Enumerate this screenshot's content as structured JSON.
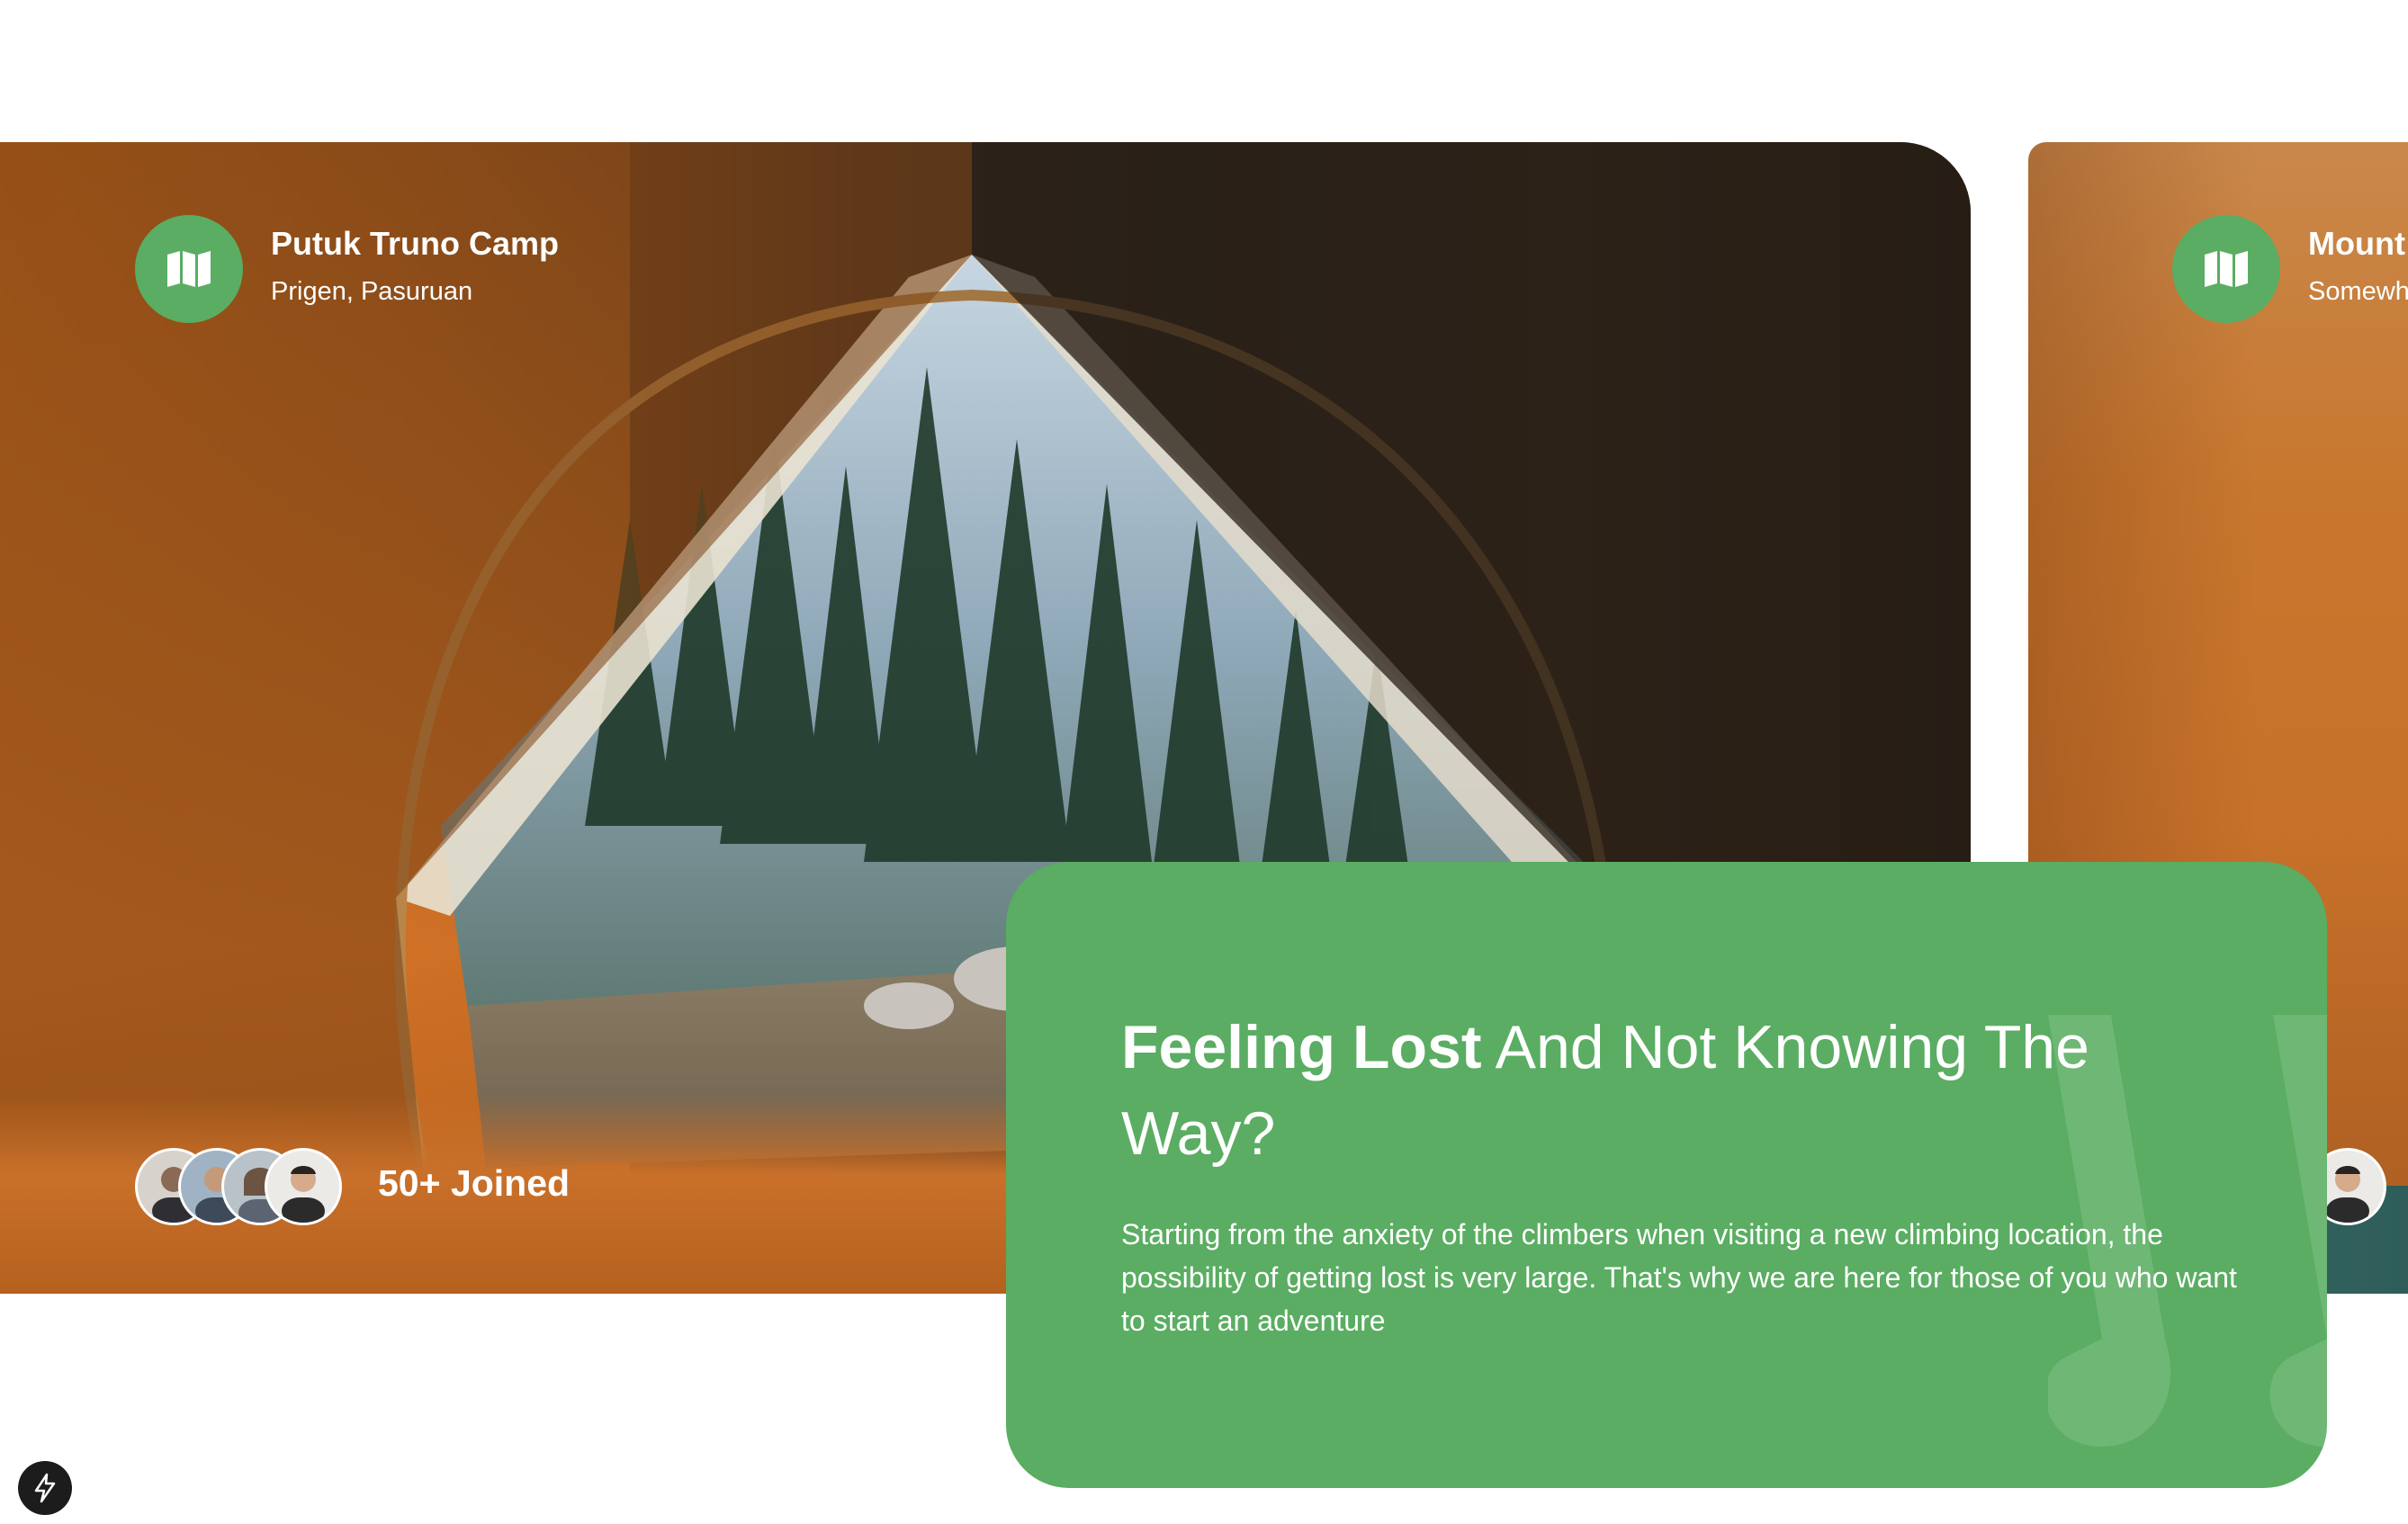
{
  "cards": [
    {
      "title": "Putuk Truno Camp",
      "subtitle": "Prigen, Pasuruan",
      "icon": "map-icon",
      "joined": "50+ Joined"
    },
    {
      "title": "Mount",
      "subtitle": "Somewh",
      "icon": "map-icon"
    }
  ],
  "quote": {
    "title_bold": "Feeling Lost",
    "title_rest": " And Not Knowing The Way?",
    "body": "Starting from the anxiety of the climbers when visiting a new climbing location, the possibility of getting lost is very large. That's why we are here for those of you who want to start an adventure"
  },
  "colors": {
    "accent_green": "#5aad62",
    "white": "#ffffff"
  },
  "floating_logo": "bolt-icon"
}
